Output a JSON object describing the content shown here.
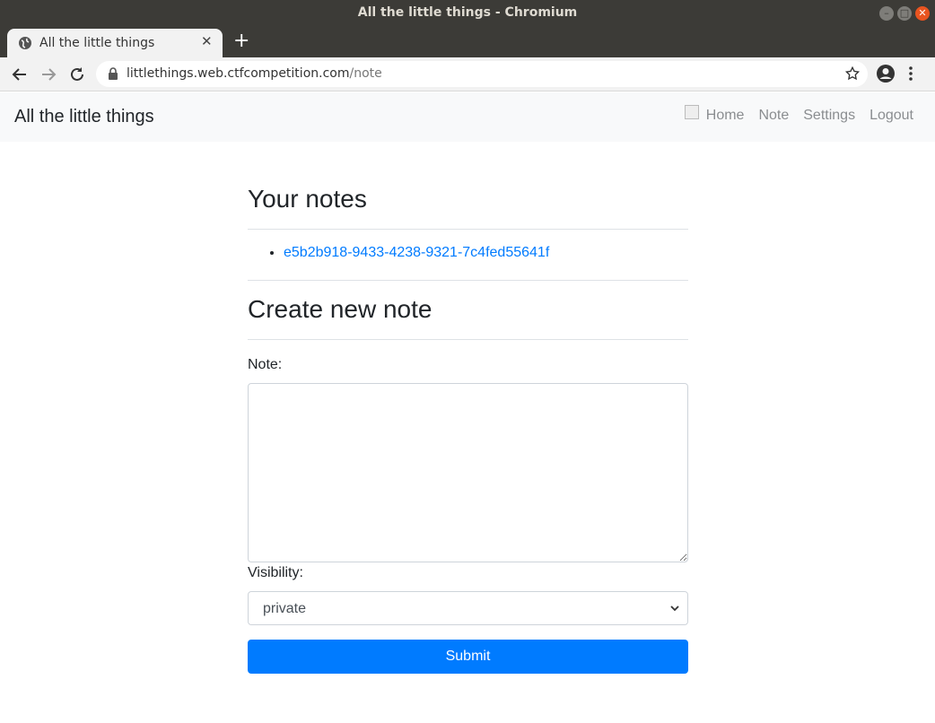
{
  "window": {
    "title": "All the little things - Chromium"
  },
  "browser": {
    "tab_title": "All the little things",
    "url_host": "littlethings.web.ctfcompetition.com",
    "url_path": "/note"
  },
  "navbar": {
    "brand": "All the little things",
    "links": [
      "Home",
      "Note",
      "Settings",
      "Logout"
    ]
  },
  "notes": {
    "heading": "Your notes",
    "items": [
      "e5b2b918-9433-4238-9321-7c4fed55641f"
    ]
  },
  "create": {
    "heading": "Create new note",
    "note_label": "Note:",
    "note_value": "",
    "visibility_label": "Visibility:",
    "visibility_value": "private",
    "submit_label": "Submit"
  },
  "colors": {
    "primary": "#007bff",
    "navbar_bg": "#f8f9fa",
    "titlebar_bg": "#3c3b37",
    "close_btn": "#e95420"
  }
}
